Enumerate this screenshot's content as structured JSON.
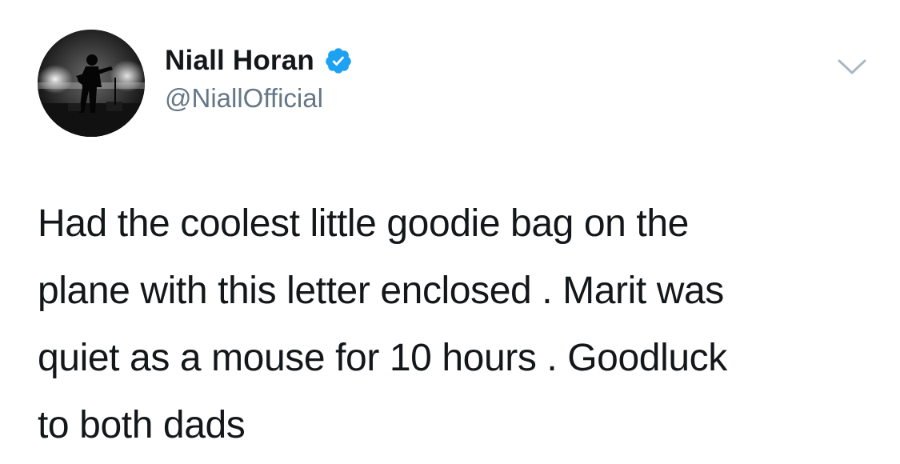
{
  "tweet": {
    "author": {
      "display_name": "Niall Horan",
      "handle": "@NiallOfficial",
      "verified": true,
      "avatar_icon": "avatar-photo-silhouette-guitarist"
    },
    "menu_icon": "chevron-down-icon",
    "text": "Had the coolest little goodie bag on the\nplane with this letter enclosed . Marit was\nquiet as a mouse for 10 hours . Goodluck\nto both dads"
  },
  "colors": {
    "verified_badge": "#1da1f2",
    "handle": "#657786",
    "text": "#14171a",
    "chevron": "#aab8c2"
  }
}
